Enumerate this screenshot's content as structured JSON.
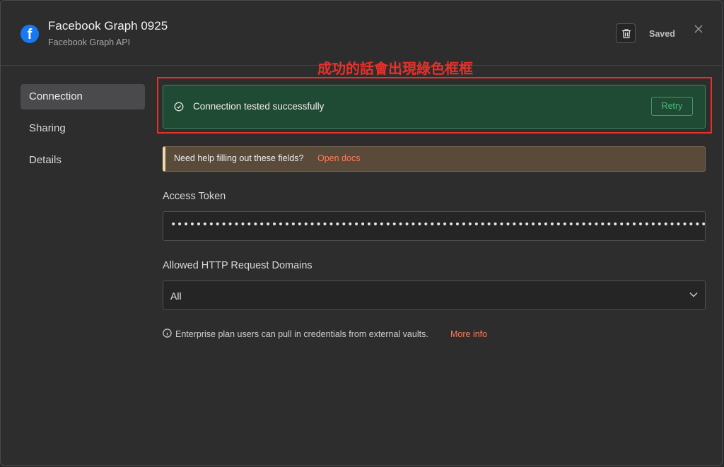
{
  "header": {
    "title": "Facebook Graph 0925",
    "subtitle": "Facebook Graph API",
    "logo_letter": "f",
    "saved_label": "Saved",
    "icons": [
      "facebook-logo-icon",
      "trash-icon",
      "close-icon"
    ]
  },
  "sidebar": {
    "items": [
      {
        "label": "Connection",
        "active": true
      },
      {
        "label": "Sharing",
        "active": false
      },
      {
        "label": "Details",
        "active": false
      }
    ]
  },
  "annotation": {
    "text": "成功的話會出現綠色框框",
    "color": "#e8302a"
  },
  "success_banner": {
    "text": "Connection tested successfully",
    "retry_label": "Retry",
    "color": "#1f4a33"
  },
  "help_banner": {
    "text": "Need help filling out these fields?",
    "link": "Open docs"
  },
  "access_token": {
    "label": "Access Token",
    "masked_value": "••••••••••••••••••••••••••••••••••••••••••••••••••••••••••••••••••••••••••••••••••••••••••••••••••"
  },
  "domains": {
    "label": "Allowed HTTP Request Domains",
    "selected": "All"
  },
  "info": {
    "text": "Enterprise plan users can pull in credentials from external vaults.",
    "link": "More info"
  }
}
